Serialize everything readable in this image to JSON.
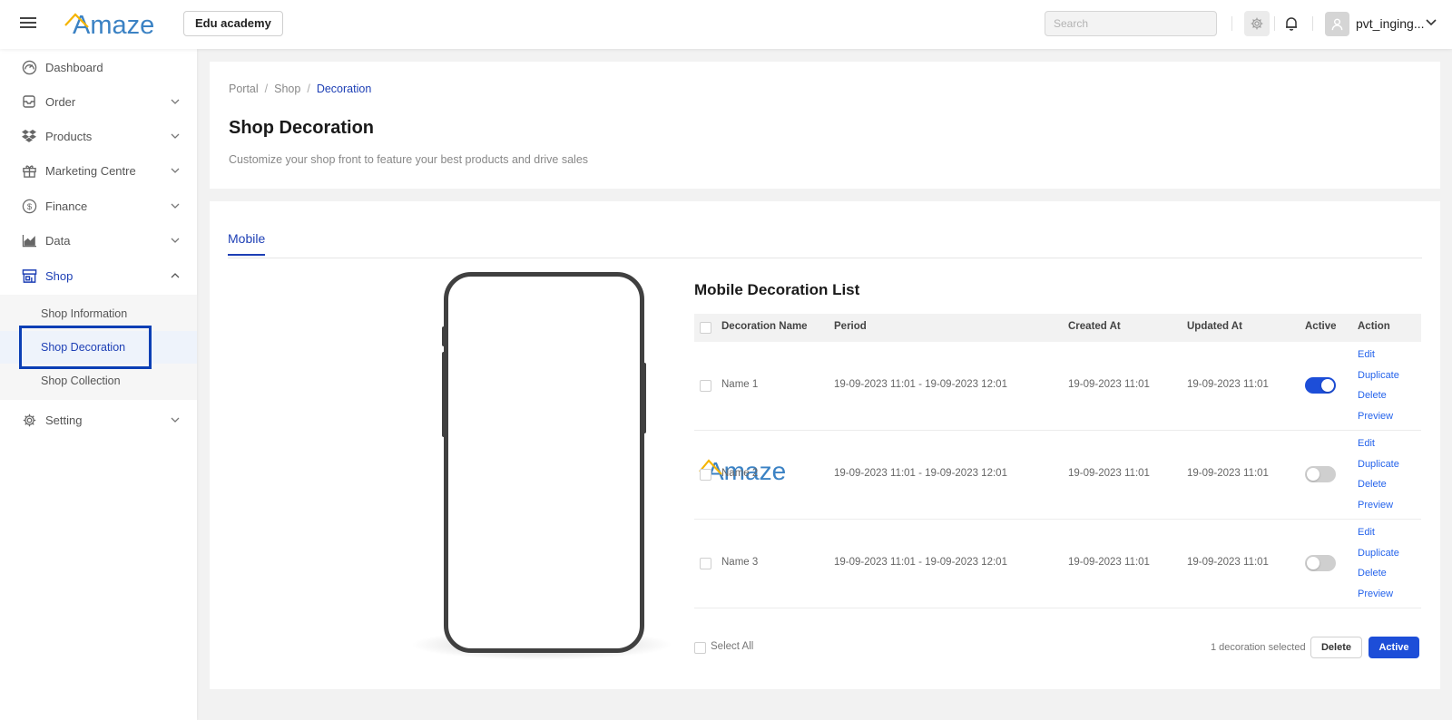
{
  "header": {
    "logo_text": "Amaze",
    "org_name": "Edu academy",
    "search_placeholder": "Search",
    "user_name": "pvt_inging..."
  },
  "sidebar": {
    "items": [
      {
        "label": "Dashboard",
        "icon": "gauge-icon"
      },
      {
        "label": "Order",
        "icon": "inbox-icon"
      },
      {
        "label": "Products",
        "icon": "dropbox-icon"
      },
      {
        "label": "Marketing Centre",
        "icon": "gift-icon"
      },
      {
        "label": "Finance",
        "icon": "dollar-circle-icon"
      },
      {
        "label": "Data",
        "icon": "area-chart-icon"
      },
      {
        "label": "Shop",
        "icon": "shop-icon"
      },
      {
        "label": "Setting",
        "icon": "gear-icon"
      }
    ],
    "shop_submenu": [
      "Shop Information",
      "Shop Decoration",
      "Shop Collection"
    ]
  },
  "breadcrumb": [
    "Portal",
    "Shop",
    "Decoration"
  ],
  "page": {
    "title": "Shop Decoration",
    "subtitle": "Customize your shop front to feature your best products and drive sales"
  },
  "tabs": [
    "Mobile"
  ],
  "phone_preview": {
    "logo_text": "Amaze"
  },
  "list": {
    "title": "Mobile Decoration List",
    "columns": [
      "Decoration Name",
      "Period",
      "Created At",
      "Updated At",
      "Active",
      "Action"
    ],
    "rows": [
      {
        "name": "Name 1",
        "period": "19-09-2023 11:01 - 19-09-2023 12:01",
        "created": "19-09-2023 11:01",
        "updated": "19-09-2023 11:01",
        "active": true
      },
      {
        "name": "Name 2",
        "period": "19-09-2023 11:01 - 19-09-2023 12:01",
        "created": "19-09-2023 11:01",
        "updated": "19-09-2023 11:01",
        "active": false
      },
      {
        "name": "Name 3",
        "period": "19-09-2023 11:01 - 19-09-2023 12:01",
        "created": "19-09-2023 11:01",
        "updated": "19-09-2023 11:01",
        "active": false
      }
    ],
    "actions": [
      "Edit",
      "Duplicate",
      "Delete",
      "Preview"
    ],
    "select_all": "Select All",
    "selected_count": "1 decoration selected",
    "delete_btn": "Delete",
    "active_btn": "Active"
  },
  "colors": {
    "brand_blue": "#1d4ed8",
    "logo_blue": "#3b82c4",
    "logo_yellow": "#f5b400",
    "link_blue": "#2563eb",
    "highlight": "#0b3fb5"
  }
}
